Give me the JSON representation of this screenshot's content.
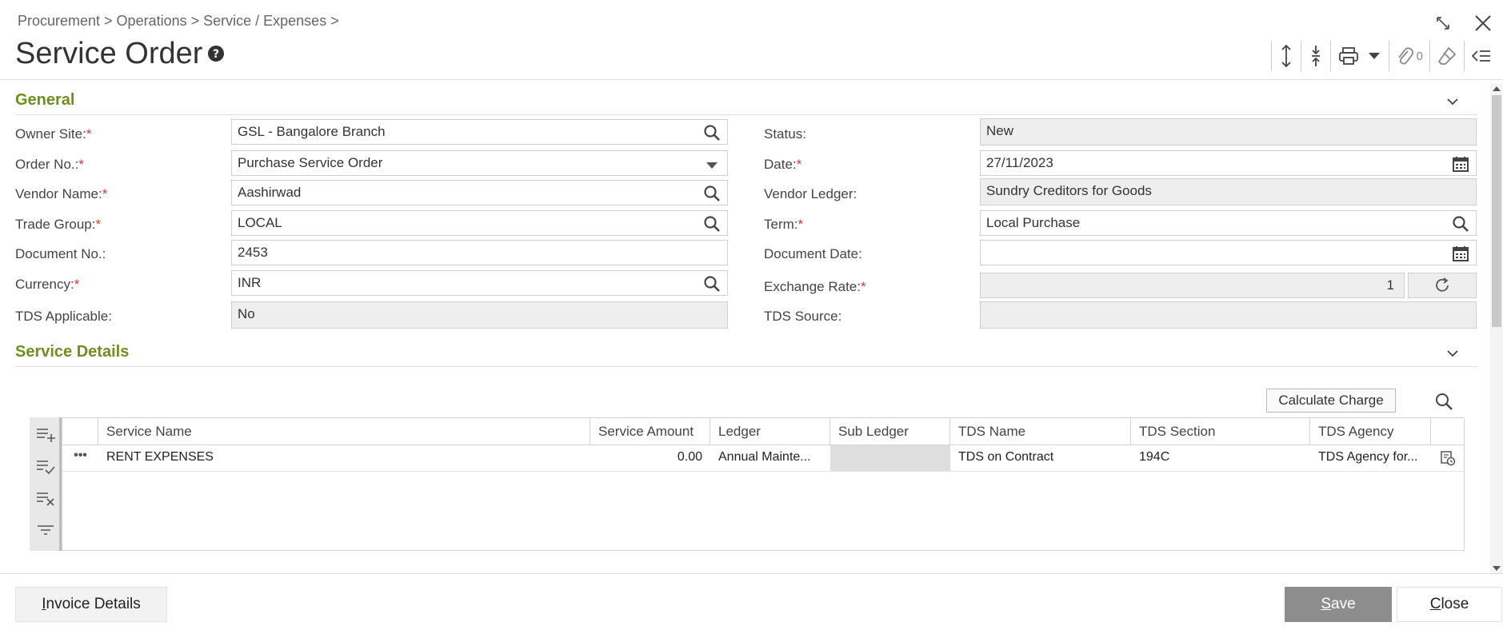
{
  "breadcrumb": "Procurement > Operations > Service / Expenses >",
  "title": "Service Order",
  "toolbar": {
    "attachment_count": "0"
  },
  "general": {
    "section_title": "General",
    "owner_site": {
      "label": "Owner Site:",
      "value": "GSL - Bangalore Branch"
    },
    "order_no": {
      "label": "Order No.:",
      "value": "Purchase Service Order"
    },
    "vendor_name": {
      "label": "Vendor Name:",
      "value": "Aashirwad"
    },
    "trade_group": {
      "label": "Trade Group:",
      "value": "LOCAL"
    },
    "document_no": {
      "label": "Document No.:",
      "value": "2453"
    },
    "currency": {
      "label": "Currency:",
      "value": "INR"
    },
    "tds_applicable": {
      "label": "TDS Applicable:",
      "value": "No"
    },
    "status": {
      "label": "Status:",
      "value": "New"
    },
    "date": {
      "label": "Date:",
      "value": "27/11/2023"
    },
    "vendor_ledger": {
      "label": "Vendor Ledger:",
      "value": "Sundry Creditors for Goods"
    },
    "term": {
      "label": "Term:",
      "value": "Local Purchase"
    },
    "document_date": {
      "label": "Document Date:",
      "value": ""
    },
    "exchange_rate": {
      "label": "Exchange Rate:",
      "value": "1"
    },
    "tds_source": {
      "label": "TDS Source:",
      "value": ""
    },
    "required_mark": "*"
  },
  "service_details": {
    "section_title": "Service Details",
    "calculate_charge": "Calculate Charge",
    "columns": [
      "Service Name",
      "Service Amount",
      "Ledger",
      "Sub Ledger",
      "TDS Name",
      "TDS Section",
      "TDS Agency"
    ],
    "rows": [
      {
        "menu": "•••",
        "service_name": "RENT EXPENSES",
        "service_amount": "0.00",
        "ledger": "Annual Mainte...",
        "sub_ledger": "",
        "tds_name": "TDS on Contract",
        "tds_section": "194C",
        "tds_agency": "TDS Agency for..."
      }
    ]
  },
  "footer": {
    "invoice_details": "Invoice Details",
    "save": "Save",
    "close": "Close"
  },
  "colors": {
    "accent": "#6e8f1f",
    "required": "#dd3333",
    "save_bg": "#8d8d8d"
  }
}
